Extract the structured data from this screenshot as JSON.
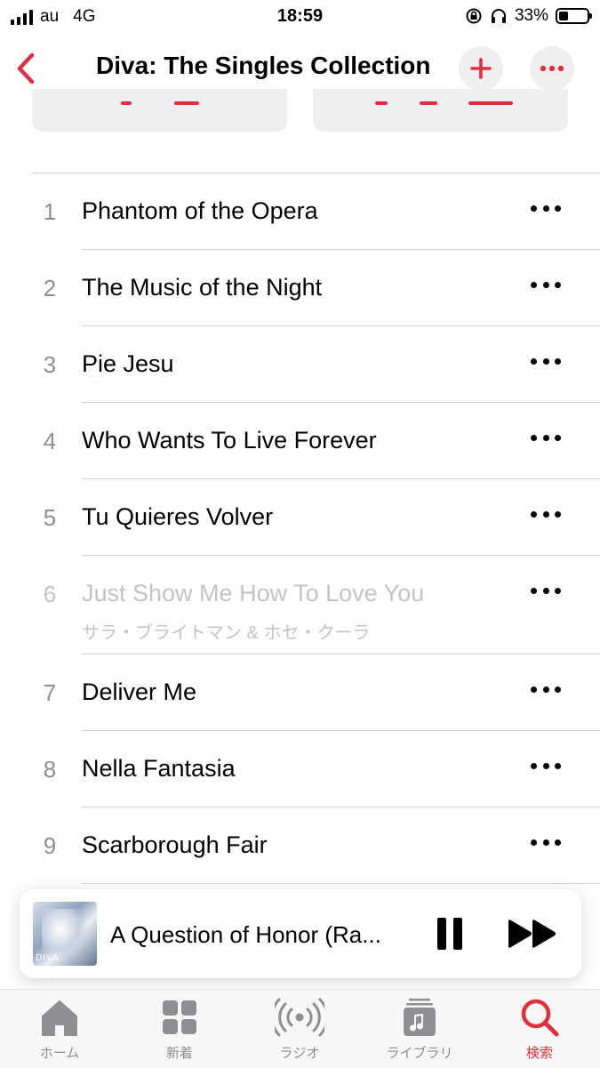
{
  "status_bar": {
    "carrier": "au",
    "network": "4G",
    "time": "18:59",
    "battery": "33%",
    "battery_level": 0.33
  },
  "nav": {
    "title": "Diva: The Singles Collection"
  },
  "tracks": [
    {
      "num": "1",
      "title": "Phantom of the Opera"
    },
    {
      "num": "2",
      "title": "The Music of the Night"
    },
    {
      "num": "3",
      "title": "Pie Jesu"
    },
    {
      "num": "4",
      "title": "Who Wants To Live Forever"
    },
    {
      "num": "5",
      "title": "Tu Quieres Volver"
    },
    {
      "num": "6",
      "title": "Just Show Me How To Love You",
      "artist": "サラ・ブライトマン & ホセ・クーラ"
    },
    {
      "num": "7",
      "title": "Deliver Me"
    },
    {
      "num": "8",
      "title": "Nella Fantasia"
    },
    {
      "num": "9",
      "title": "Scarborough Fair"
    }
  ],
  "mini_player": {
    "title": "A Question of Honor (Ra...",
    "artwork_label": "DIVA"
  },
  "tabs": [
    {
      "label": "ホーム",
      "icon": "home-icon"
    },
    {
      "label": "新着",
      "icon": "grid-icon"
    },
    {
      "label": "ラジオ",
      "icon": "radio-icon"
    },
    {
      "label": "ライブラリ",
      "icon": "library-icon"
    },
    {
      "label": "検索",
      "icon": "search-icon",
      "active": true
    }
  ],
  "colors": {
    "accent": "#e0303d",
    "secondary_text": "#8e8e93",
    "dimmed_text": "#c4c4c8",
    "button_bg": "#efeff1"
  }
}
